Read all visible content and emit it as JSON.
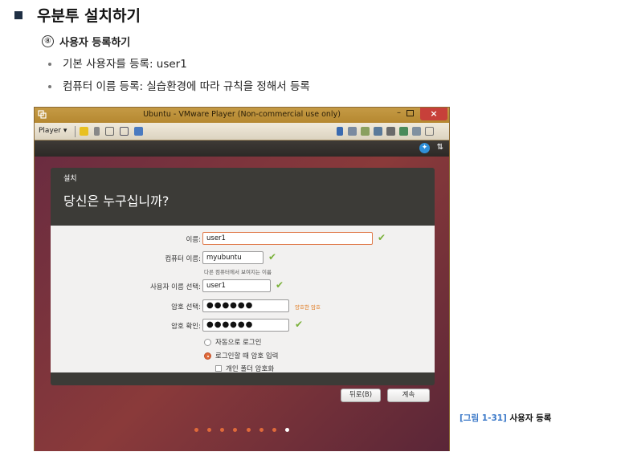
{
  "doc": {
    "heading": "우분투 설치하기",
    "step_num": "⑧",
    "step_title": "사용자 등록하기",
    "bullets": [
      "기본 사용자를 등록: user1",
      "컴퓨터 이름 등록: 실습환경에 따라 규칙을 정해서 등록"
    ],
    "caption_num": "[그림 1-31]",
    "caption_text": "사용자 등록"
  },
  "window": {
    "title": "Ubuntu - VMware Player (Non-commercial use only)",
    "player_menu": "Player ▾",
    "close_label": "×",
    "min_label": "–"
  },
  "dialog": {
    "title": "설치",
    "heading": "당신은 누구십니까?",
    "name_label": "이름:",
    "name_value": "user1",
    "computer_label": "컴퓨터 이름:",
    "computer_value": "myubuntu",
    "computer_hint": "다른 컴퓨터에서 보여지는 이름",
    "username_label": "사용자 이름 선택:",
    "username_value": "user1",
    "password_label": "암호 선택:",
    "password_value": "●●●●●●",
    "password_strength": "양호한 암호",
    "confirm_label": "암호 확인:",
    "confirm_value": "●●●●●●",
    "option_autologin": "자동으로 로그인",
    "option_require_pw": "로그인할 때 암호 입력",
    "option_encrypt": "개인 폴더 암호화",
    "back_button": "뒤로(B)",
    "continue_button": "계속",
    "selected_option": "로그인할 때 암호 입력"
  },
  "progress": {
    "total_steps": 8,
    "current_step": 8
  },
  "colors": {
    "accent": "#e06a3a",
    "check": "#7ab13a",
    "titlebar": "#c59a45"
  }
}
